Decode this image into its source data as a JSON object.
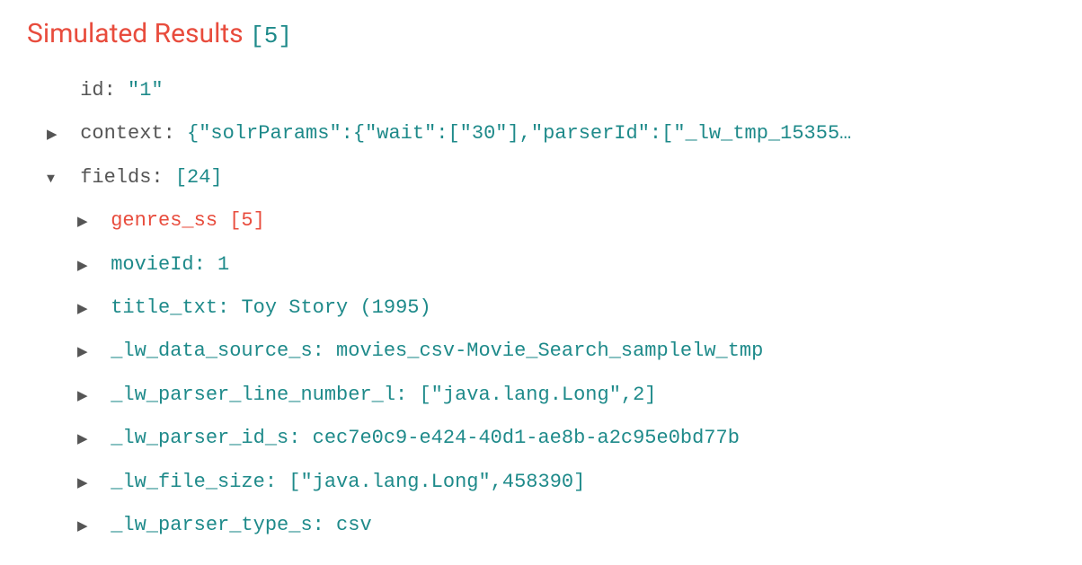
{
  "heading": {
    "title": "Simulated Results",
    "count": "[5]"
  },
  "tree": {
    "id_key": "id:",
    "id_val": "\"1\"",
    "context_key": "context:",
    "context_val": "{\"solrParams\":{\"wait\":[\"30\"],\"parserId\":[\"_lw_tmp_15355…",
    "fields_key": "fields:",
    "fields_count": "[24]",
    "items": {
      "genres_key": "genres_ss",
      "genres_count": "[5]",
      "movieId_key": "movieId:",
      "movieId_val": "1",
      "title_key": "title_txt:",
      "title_val": "Toy Story (1995)",
      "data_source_key": "_lw_data_source_s:",
      "data_source_val": "movies_csv-Movie_Search_samplelw_tmp",
      "parser_line_key": "_lw_parser_line_number_l:",
      "parser_line_val": "[\"java.lang.Long\",2]",
      "parser_id_key": "_lw_parser_id_s:",
      "parser_id_val": "cec7e0c9-e424-40d1-ae8b-a2c95e0bd77b",
      "file_size_key": "_lw_file_size:",
      "file_size_val": "[\"java.lang.Long\",458390]",
      "parser_type_key": "_lw_parser_type_s:",
      "parser_type_val": "csv"
    }
  }
}
